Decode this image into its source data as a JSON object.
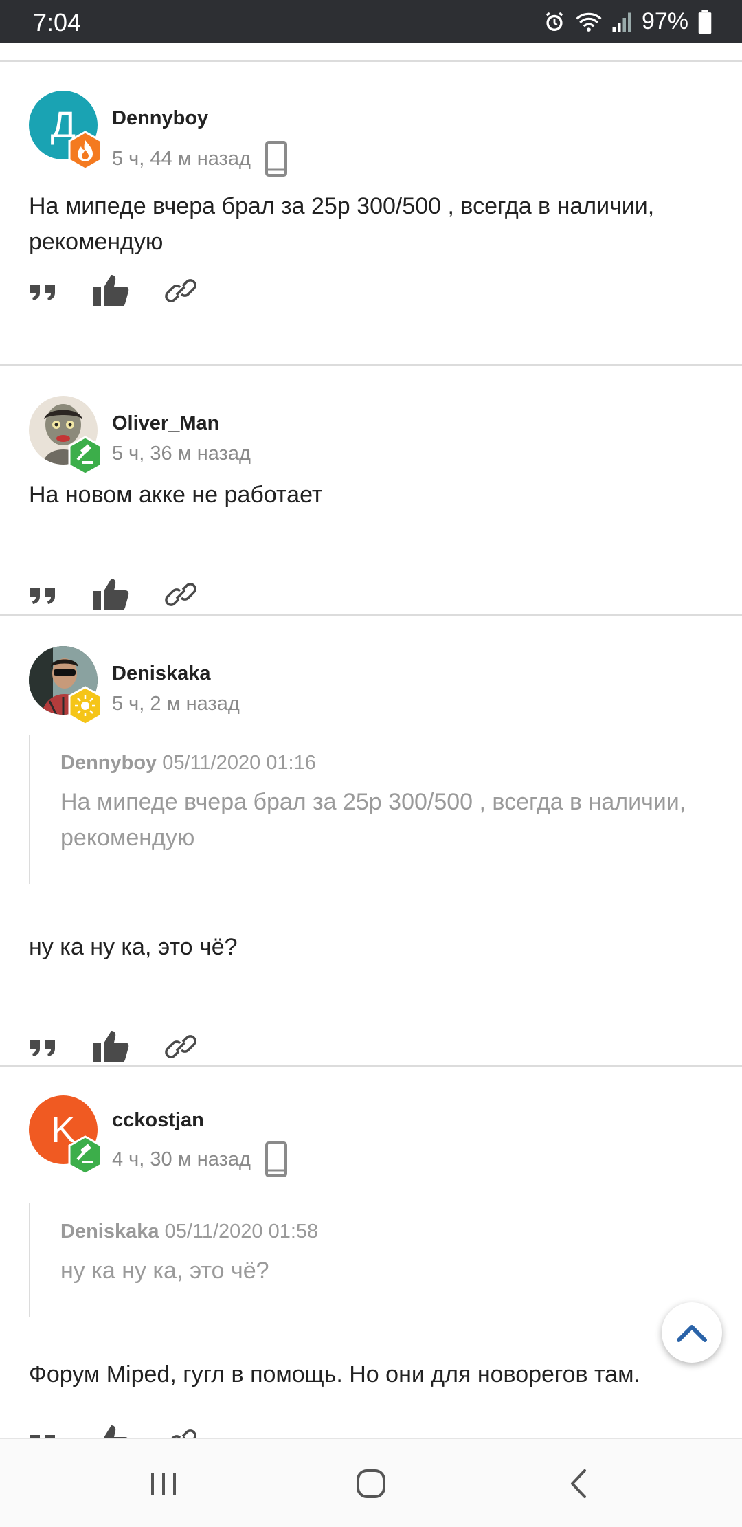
{
  "status_bar": {
    "time": "7:04",
    "battery": "97%",
    "icons": [
      "alarm-icon",
      "wifi-icon",
      "signal-icon",
      "battery-icon"
    ]
  },
  "colors": {
    "avatar_teal": "#1aa3b3",
    "avatar_orange": "#f05a22",
    "badge_orange": "#f47a20",
    "badge_green": "#3cae4a",
    "badge_yellow": "#f5c518",
    "fab_arrow": "#2a63a8"
  },
  "posts": [
    {
      "author": "Dennyboy",
      "avatar_letter": "Д",
      "time": "5 ч, 44 м назад",
      "device": "mobile-icon",
      "text": "На мипеде вчера брал за 25р 300/500 , всегда в наличии, рекомендую"
    },
    {
      "author": "Oliver_Man",
      "time": "5 ч, 36 м назад",
      "text": "На новом акке не работает"
    },
    {
      "author": "Deniskaka",
      "time": "5 ч, 2 м назад",
      "quote": {
        "author": "Dennyboy",
        "date": "05/11/2020 01:16",
        "text": "На мипеде вчера брал за 25р 300/500 , всегда в наличии, рекомендую"
      },
      "text": "ну ка ну ка, это чё?"
    },
    {
      "author": "cckostjan",
      "avatar_letter": "K",
      "time": "4 ч, 30 м назад",
      "device": "mobile-icon",
      "quote": {
        "author": "Deniskaka",
        "date": "05/11/2020 01:58",
        "text": "ну ка ну ка, это чё?"
      },
      "text": "Форум Miped, гугл в помощь. Но они для новорегов там."
    }
  ],
  "nav": [
    "recent-apps-icon",
    "home-icon",
    "back-icon"
  ]
}
